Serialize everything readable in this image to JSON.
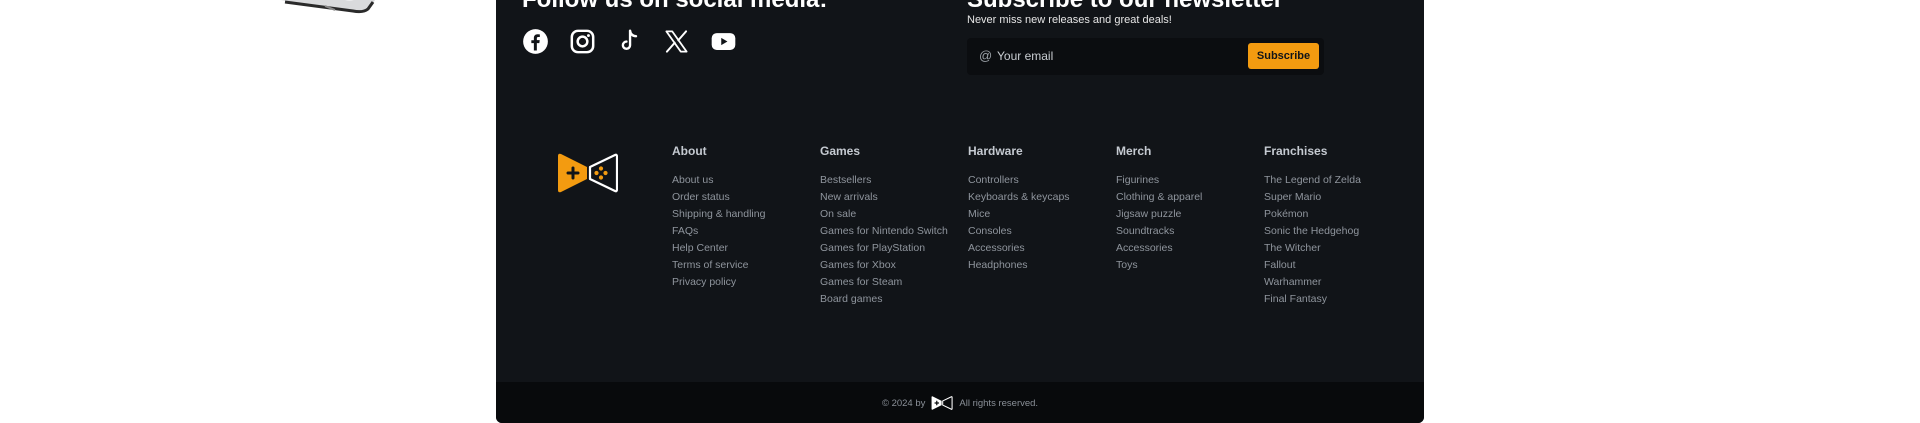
{
  "social": {
    "title": "Follow us on social media:",
    "icons": [
      "facebook-icon",
      "instagram-icon",
      "tiktok-icon",
      "x-icon",
      "youtube-icon"
    ]
  },
  "newsletter": {
    "title": "Subscribe to our newsletter",
    "subtitle": "Never miss new releases and great deals!",
    "placeholder": "Your email",
    "button": "Subscribe"
  },
  "colors": {
    "footer_bg": "#111418",
    "accent": "#f39b10",
    "bottom_bar": "#080a0c"
  },
  "columns": [
    {
      "title": "About",
      "links": [
        "About us",
        "Order status",
        "Shipping & handling",
        "FAQs",
        "Help Center",
        "Terms of service",
        "Privacy policy"
      ]
    },
    {
      "title": "Games",
      "links": [
        "Bestsellers",
        "New arrivals",
        "On sale",
        "Games for Nintendo Switch",
        "Games for PlayStation",
        "Games for Xbox",
        "Games for Steam",
        "Board games"
      ]
    },
    {
      "title": "Hardware",
      "links": [
        "Controllers",
        "Keyboards & keycaps",
        "Mice",
        "Consoles",
        "Accessories",
        "Headphones"
      ]
    },
    {
      "title": "Merch",
      "links": [
        "Figurines",
        "Clothing & apparel",
        "Jigsaw puzzle",
        "Soundtracks",
        "Accessories",
        "Toys"
      ]
    },
    {
      "title": "Franchises",
      "links": [
        "The Legend of Zelda",
        "Super Mario",
        "Pokémon",
        "Sonic the Hedgehog",
        "The Witcher",
        "Fallout",
        "Warhammer",
        "Final Fantasy"
      ]
    }
  ],
  "footer_bottom": {
    "prefix": "© 2024 by",
    "suffix": "All rights reserved."
  }
}
